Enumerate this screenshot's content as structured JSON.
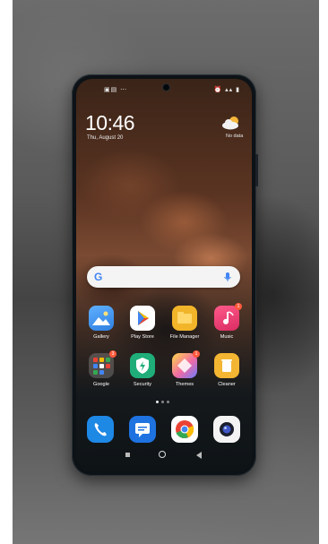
{
  "status_bar": {
    "left_icons": "▣▤ ⋯",
    "right_icons": "⏰ ▴▴ ▮"
  },
  "lock": {
    "time": "10:46",
    "date": "Thu, August 20",
    "weather": "No data"
  },
  "search": {
    "logo": "G"
  },
  "apps_row1": [
    {
      "label": "Gallery"
    },
    {
      "label": "Play Store"
    },
    {
      "label": "File Manager"
    },
    {
      "label": "Music",
      "badge": "1"
    }
  ],
  "apps_row2": [
    {
      "label": "Google",
      "badge": "3"
    },
    {
      "label": "Security"
    },
    {
      "label": "Themes",
      "badge": "1"
    },
    {
      "label": "Cleaner"
    }
  ],
  "dock": [
    "phone-icon",
    "messages-icon",
    "chrome-icon",
    "camera-icon"
  ],
  "colors": {
    "gallery": "#3c8ee6",
    "play": "#ffffff",
    "files": "#f2b52a",
    "music": "#e8416c",
    "security": "#1fae7a",
    "themes": "#f06aa4",
    "cleaner": "#f3b532",
    "phone": "#1e88e5",
    "messages": "#1e73e0"
  }
}
